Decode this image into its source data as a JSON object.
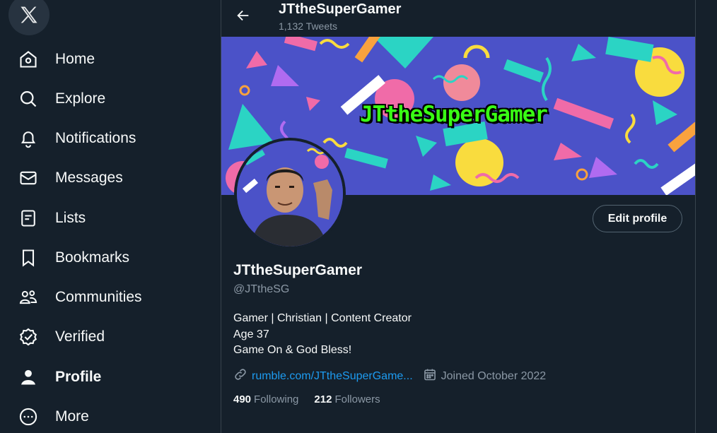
{
  "sidebar": {
    "logo_icon": "x-logo-icon",
    "items": [
      {
        "label": "Home",
        "icon": "home-icon"
      },
      {
        "label": "Explore",
        "icon": "search-icon"
      },
      {
        "label": "Notifications",
        "icon": "bell-icon"
      },
      {
        "label": "Messages",
        "icon": "envelope-icon"
      },
      {
        "label": "Lists",
        "icon": "list-icon"
      },
      {
        "label": "Bookmarks",
        "icon": "bookmark-icon"
      },
      {
        "label": "Communities",
        "icon": "people-icon"
      },
      {
        "label": "Verified",
        "icon": "verified-icon"
      },
      {
        "label": "Profile",
        "icon": "person-icon",
        "active": true
      },
      {
        "label": "More",
        "icon": "more-circle-icon"
      }
    ]
  },
  "header": {
    "name": "JTtheSuperGamer",
    "tweet_count": "1,132 Tweets"
  },
  "banner": {
    "title": "JTtheSuperGamer"
  },
  "profile": {
    "edit_label": "Edit profile",
    "name": "JTtheSuperGamer",
    "handle": "@JTtheSG",
    "bio": [
      "Gamer | Christian | Content Creator",
      "Age 37",
      "Game On & God Bless!"
    ],
    "link": "rumble.com/JTtheSuperGame...",
    "joined": "Joined October 2022",
    "following_count": "490",
    "following_label": "Following",
    "followers_count": "212",
    "followers_label": "Followers"
  },
  "colors": {
    "background": "#15202b",
    "accent": "#1d9bf0",
    "muted": "#8b98a5",
    "banner_bg": "#4b52c8"
  }
}
